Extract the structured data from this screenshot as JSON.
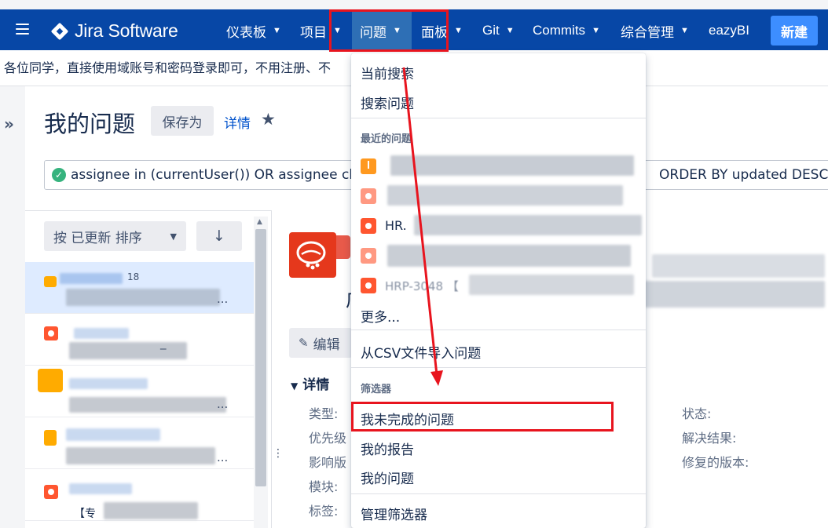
{
  "nav": {
    "product": "Jira Software",
    "items": [
      {
        "label": "仪表板"
      },
      {
        "label": "项目"
      },
      {
        "label": "问题"
      },
      {
        "label": "面板"
      },
      {
        "label": "Git"
      },
      {
        "label": "Commits"
      },
      {
        "label": "综合管理"
      },
      {
        "label": "eazyBI"
      }
    ],
    "create_label": "新建"
  },
  "announcement": "各位同学，直接使用域账号和密码登录即可，不用注册、不",
  "header": {
    "title": "我的问题",
    "save_as": "保存为",
    "details": "详情"
  },
  "jql": {
    "text": "assignee in (currentUser()) OR assignee change",
    "tail": "ORDER BY updated DESC"
  },
  "list": {
    "sort_label": "按 已更新 排序",
    "sort_direction": "↓",
    "items": [
      {
        "key": "18",
        "tail": "..."
      },
      {
        "key": "",
        "tail": "_"
      },
      {
        "key": "",
        "tail": "..."
      },
      {
        "key": "",
        "tail": "..."
      },
      {
        "key": "【专",
        "tail": ""
      }
    ]
  },
  "detail": {
    "title_fragment": "广",
    "edit_label": "编辑",
    "section": "详情",
    "fields_left": [
      "类型:",
      "优先级",
      "影响版",
      "模块:",
      "标签:"
    ],
    "fields_right": [
      "状态:",
      "解决结果:",
      "修复的版本:"
    ]
  },
  "dropdown": {
    "current_search": "当前搜索",
    "search_issues": "搜索问题",
    "recent_header": "最近的问题",
    "recent": [
      {
        "type": "warning",
        "text": ""
      },
      {
        "type": "bug",
        "text": ""
      },
      {
        "type": "bug",
        "text": "HR."
      },
      {
        "type": "bug",
        "text": ""
      },
      {
        "type": "bug",
        "text": "HRP-3048 【"
      }
    ],
    "more": "更多...",
    "import_csv": "从CSV文件导入问题",
    "filters_header": "筛选器",
    "filters": [
      "我未完成的问题",
      "我的报告",
      "我的问题"
    ],
    "manage_filters": "管理筛选器"
  },
  "colors": {
    "nav_bg": "#0747a6",
    "nav_active": "#2e6fb5",
    "create_btn": "#3d8eff",
    "annotation_red": "#e8141e",
    "bug": "#ff5630",
    "link": "#0052cc"
  }
}
